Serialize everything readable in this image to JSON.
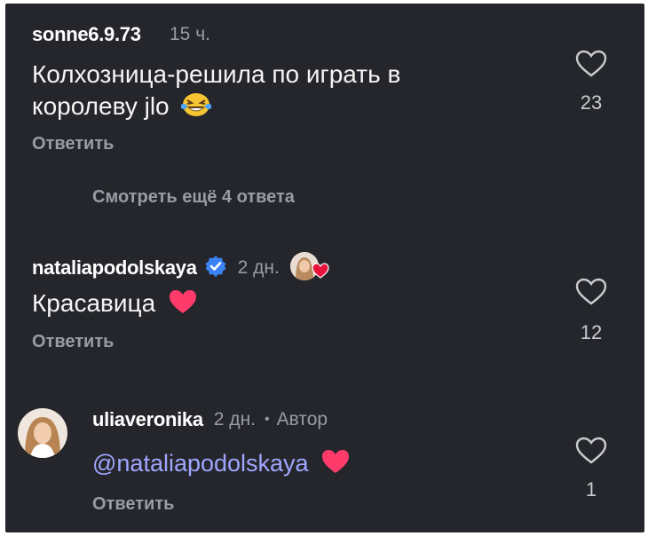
{
  "comments": [
    {
      "username": "sonne6.9.73",
      "time": "15 ч.",
      "text_line1": "Колхозница-решила по играть в",
      "text_line2": "королеву jlo",
      "emoji": "laughing-tears-emoji",
      "reply_label": "Ответить",
      "likes": "23"
    },
    {
      "view_more": "Смотреть ещё 4 ответа"
    },
    {
      "username": "nataliapodolskaya",
      "verified": true,
      "time": "2 дн.",
      "text": "Красавица",
      "emoji": "heart-emoji",
      "reply_label": "Ответить",
      "likes": "12"
    },
    {
      "username": "uliaveronika",
      "time": "2 дн.",
      "separator": "•",
      "author_label": "Автор",
      "mention": "@nataliapodolskaya",
      "emoji": "heart-emoji",
      "reply_label": "Ответить",
      "likes": "1"
    }
  ],
  "colors": {
    "background": "#25262b",
    "text": "#f5f5f5",
    "muted": "#9a9ca3",
    "mention": "#9fa6ff",
    "verified": "#3b82f6",
    "heart": "#ff3b6b"
  }
}
